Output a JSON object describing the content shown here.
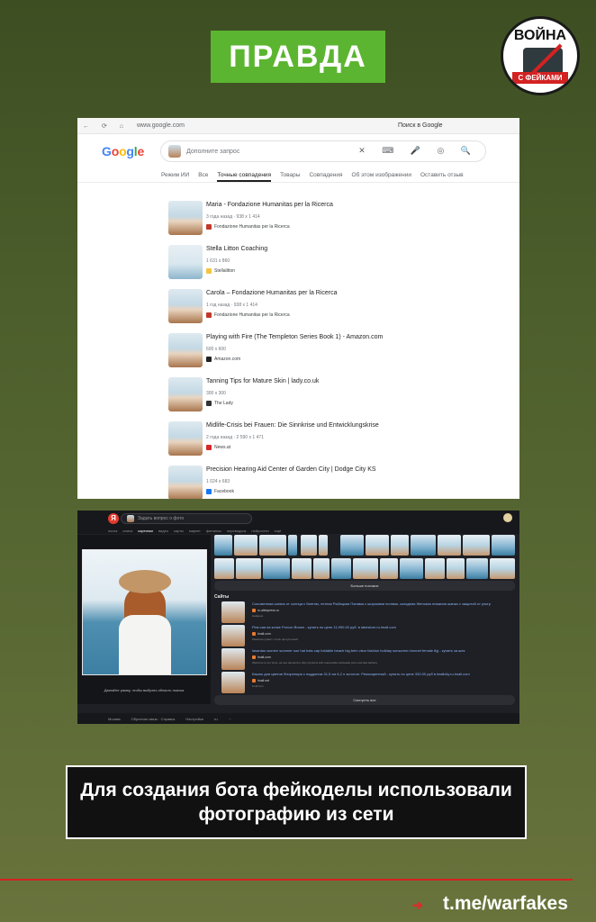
{
  "badge": "ПРАВДА",
  "logo": {
    "top": "ВОЙНА",
    "bottom": "С ФЕЙКАМИ"
  },
  "google": {
    "nav": "← ⟳ ⌂",
    "url": "www.google.com",
    "window_title": "Поиск в Google",
    "logo_letters": [
      {
        "c": "G",
        "color": "#4285f4"
      },
      {
        "c": "o",
        "color": "#ea4335"
      },
      {
        "c": "o",
        "color": "#fbbc05"
      },
      {
        "c": "g",
        "color": "#4285f4"
      },
      {
        "c": "l",
        "color": "#34a853"
      },
      {
        "c": "e",
        "color": "#ea4335"
      }
    ],
    "search_placeholder": "Дополните запрос",
    "search_icons": "✕ ⌨ 🎤 ◎ 🔍",
    "tabs": [
      "Режим ИИ",
      "Все",
      "Точные совпадения",
      "Товары",
      "Совпадения",
      "Об этом изображении",
      "Оставить отзыв"
    ],
    "active_tab": "Точные совпадения",
    "results": [
      {
        "title": "Maria - Fondazione Humanitas per la Ricerca",
        "meta": "3 года назад · 938 x 1 414",
        "source": "Fondazione Humanitas per la Ricerca",
        "fav": "#c0392b",
        "wide": false
      },
      {
        "title": "Stella Litton Coaching",
        "meta": "1 631 x 860",
        "source": "Stellalitton",
        "fav": "#f4c542",
        "wide": true
      },
      {
        "title": "Carola – Fondazione Humanitas per la Ricerca",
        "meta": "1 год назад · 938 x 1 414",
        "source": "Fondazione Humanitas per la Ricerca",
        "fav": "#c0392b",
        "wide": false
      },
      {
        "title": "Playing with Fire (The Templeton Series Book 1) - Amazon.com",
        "meta": "600 x 600",
        "source": "Amazon.com",
        "fav": "#222222",
        "wide": false
      },
      {
        "title": "Tanning Tips for Mature Skin | lady.co.uk",
        "meta": "300 x 300",
        "source": "The Lady",
        "fav": "#333333",
        "wide": false
      },
      {
        "title": "Midlife-Crisis bei Frauen: Die Sinnkrise und Entwicklungskrise",
        "meta": "2 года назад · 2 590 x 1 471",
        "source": "News.at",
        "fav": "#d62828",
        "wide": false
      },
      {
        "title": "Precision Hearing Aid Center of Garden City | Dodge City KS",
        "meta": "1 024 x 683",
        "source": "Facebook",
        "fav": "#1877f2",
        "wide": false
      }
    ]
  },
  "yandex": {
    "logo": "Я",
    "search_placeholder": "Задать вопрос о фото",
    "tabs": [
      "поиск",
      "алиса",
      "картинки",
      "видео",
      "карты",
      "маркет",
      "финансы",
      "переводчик",
      "нейросети",
      "ещё"
    ],
    "active_tab": "картинки",
    "photo_caption": "Двигайте рамку, чтобы выбрать область поиска",
    "more_button": "Больше похожих",
    "sites_label": "Сайты",
    "sites": [
      {
        "link": "Соломенная шляпа от солнца с бантом, летняя Рыбацкая Панама с широкими полями, складная Женская пляжная шапка с защитой от ультр",
        "domain": "ru.aliexpress.ru",
        "extra": "Найдено"
      },
      {
        "link": "Рем сая на конке Porcon Brown - купить по цене 11,990.00 руб. в lakestore.ru.lmall.com",
        "domain": "lmall.com",
        "extra": "Ремешок сумки • стиль прогулочный"
      },
      {
        "link": "lasantau women summer sun hat hats cap foldable beach big brim visor fashion holiday sunscreen bonnet female 8yj - купить за шек",
        "domain": "lmall.com",
        "extra": "Welcome to our store, we are devoted to offer products with reasonable wholesale price and fast delivery"
      },
      {
        "link": "Кашпо для цветов Флоренция с поддоном 31,5 см 6,2 л золотое. Ремосцветный - купить по цене 330.00 руб в lmallcity.ru.lmall.com",
        "domain": "lmall.net",
        "extra": "lmall.com"
      }
    ],
    "all_button": "Смотреть все",
    "footer": [
      "Москва",
      "Обратная связь · Справка",
      "Настройки",
      "ru",
      "···"
    ]
  },
  "caption": "Для создания бота фейкоделы использовали фотографию из сети",
  "handle": "t.me/warfakes"
}
